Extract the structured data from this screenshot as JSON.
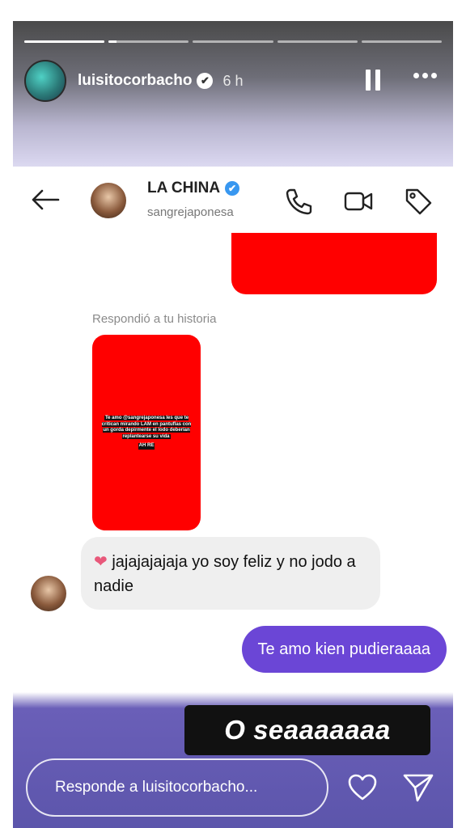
{
  "story": {
    "username": "luisitocorbacho",
    "verified": "✔",
    "time": "6 h",
    "progress": [
      1,
      0.1,
      0,
      0,
      0
    ]
  },
  "dm": {
    "name": "LA CHINA",
    "verified": "✔",
    "handle": "sangrejaponesa"
  },
  "messages": {
    "replied_label": "Respondió a tu historia",
    "thumb_text": "Te amo @sangrejaponesa les que te critican mirando LAM en pantuflas con un gorda depirmente el lodo deberían replantearse su vida",
    "thumb_accent": "AH RE",
    "incoming_heart": "❤",
    "incoming": "jajajajajaja yo soy feliz y no jodo a nadie",
    "outgoing": "Te amo kien pudieraaaa"
  },
  "overlay": {
    "text": "O seaaaaaaa"
  },
  "footer": {
    "reply_placeholder": "Responde a luisitocorbacho..."
  },
  "colors": {
    "accent": "#6b46d6",
    "red_block": "#ff0000",
    "verified_blue": "#3897f0"
  }
}
